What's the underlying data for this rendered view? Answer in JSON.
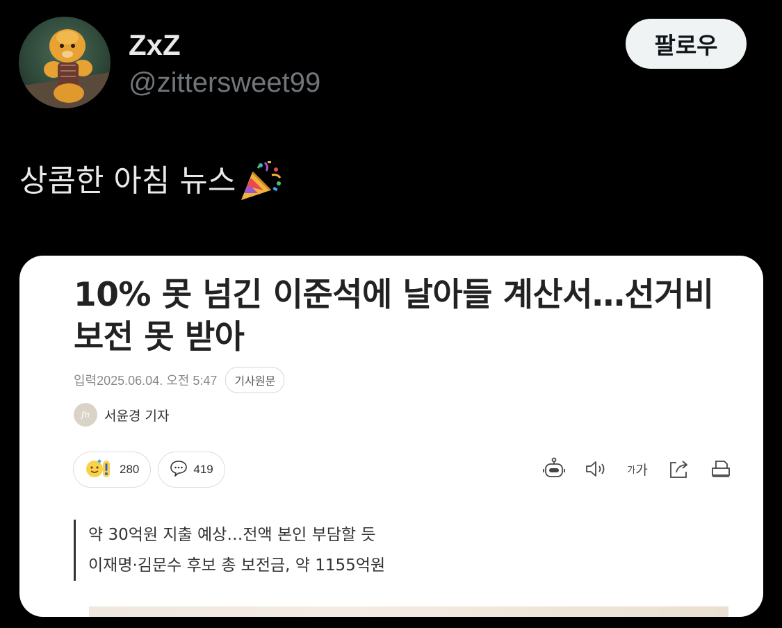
{
  "user": {
    "display_name": "ZxZ",
    "handle": "@zittersweet99"
  },
  "follow_label": "팔로우",
  "tweet": {
    "text": "상콤한 아침 뉴스",
    "emoji_icon": "party-popper-icon"
  },
  "article": {
    "headline_line1": "10% 못 넘긴 이준석에 날아들 계산서…선거비",
    "headline_line2": "보전 못 받아",
    "date": "입력2025.06.04. 오전 5:47",
    "original_label": "기사원문",
    "reporter_logo": "fn",
    "reporter": "서윤경 기자",
    "reactions": {
      "emoji_count": "280",
      "comment_count": "419"
    },
    "tools": {
      "font_size_small": "가",
      "font_size_large": "가"
    },
    "subtitles": [
      "약 30억원 지출 예상…전액 본인 부담할 듯",
      "이재명·김문수 후보 총 보전금, 약 1155억원"
    ]
  },
  "colors": {
    "background": "#000000",
    "primary_text": "#e7e9ea",
    "secondary_text": "#71767b",
    "follow_button_bg": "#eff3f4",
    "card_bg": "#ffffff"
  }
}
